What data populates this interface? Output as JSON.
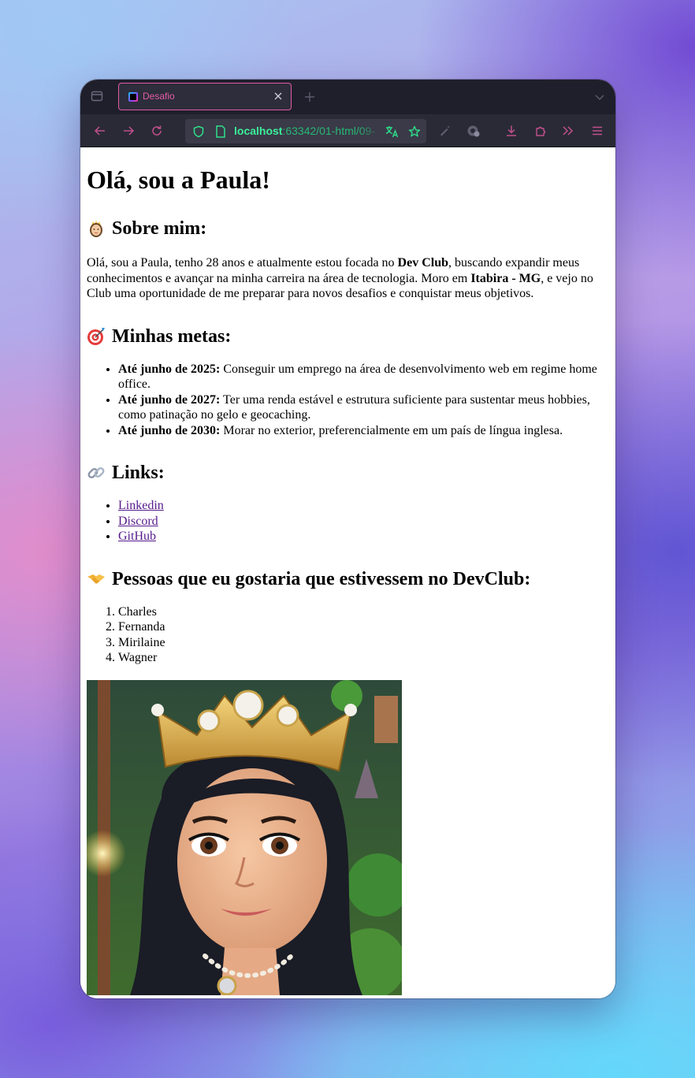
{
  "browser": {
    "tab": {
      "title": "Desafio"
    },
    "url": {
      "host": "localhost",
      "rest": ":63342/01-html/09-"
    },
    "accent": "#e35ca6",
    "url_color": "#3bf09a"
  },
  "page": {
    "heading": "Olá, sou a Paula!",
    "about": {
      "title": "Sobre mim:",
      "icon": "princess-emoji",
      "text_1": "Olá, sou a Paula, tenho 28 anos e atualmente estou focada no ",
      "bold_1": "Dev Club",
      "text_2": ", buscando expandir meus conhecimentos e avançar na minha carreira na área de tecnologia. Moro em ",
      "bold_2": "Itabira - MG",
      "text_3": ", e vejo no Club uma oportunidade de me preparar para novos desafios e conquistar meus objetivos."
    },
    "goals": {
      "title": "Minhas metas:",
      "icon": "target-emoji",
      "items": [
        {
          "label": "Até junho de 2025:",
          "text": " Conseguir um emprego na área de desenvolvimento web em regime home office."
        },
        {
          "label": "Até junho de 2027:",
          "text": " Ter uma renda estável e estrutura suficiente para sustentar meus hobbies, como patinação no gelo e geocaching."
        },
        {
          "label": "Até junho de 2030:",
          "text": " Morar no exterior, preferencialmente em um país de língua inglesa."
        }
      ]
    },
    "links": {
      "title": "Links:",
      "icon": "link-emoji",
      "items": [
        "Linkedin",
        "Discord",
        "GitHub"
      ]
    },
    "people": {
      "title": "Pessoas que eu gostaria que estivessem no DevClub:",
      "icon": "handshake-emoji",
      "items": [
        "Charles",
        "Fernanda",
        "Mirilaine",
        "Wagner"
      ]
    }
  }
}
